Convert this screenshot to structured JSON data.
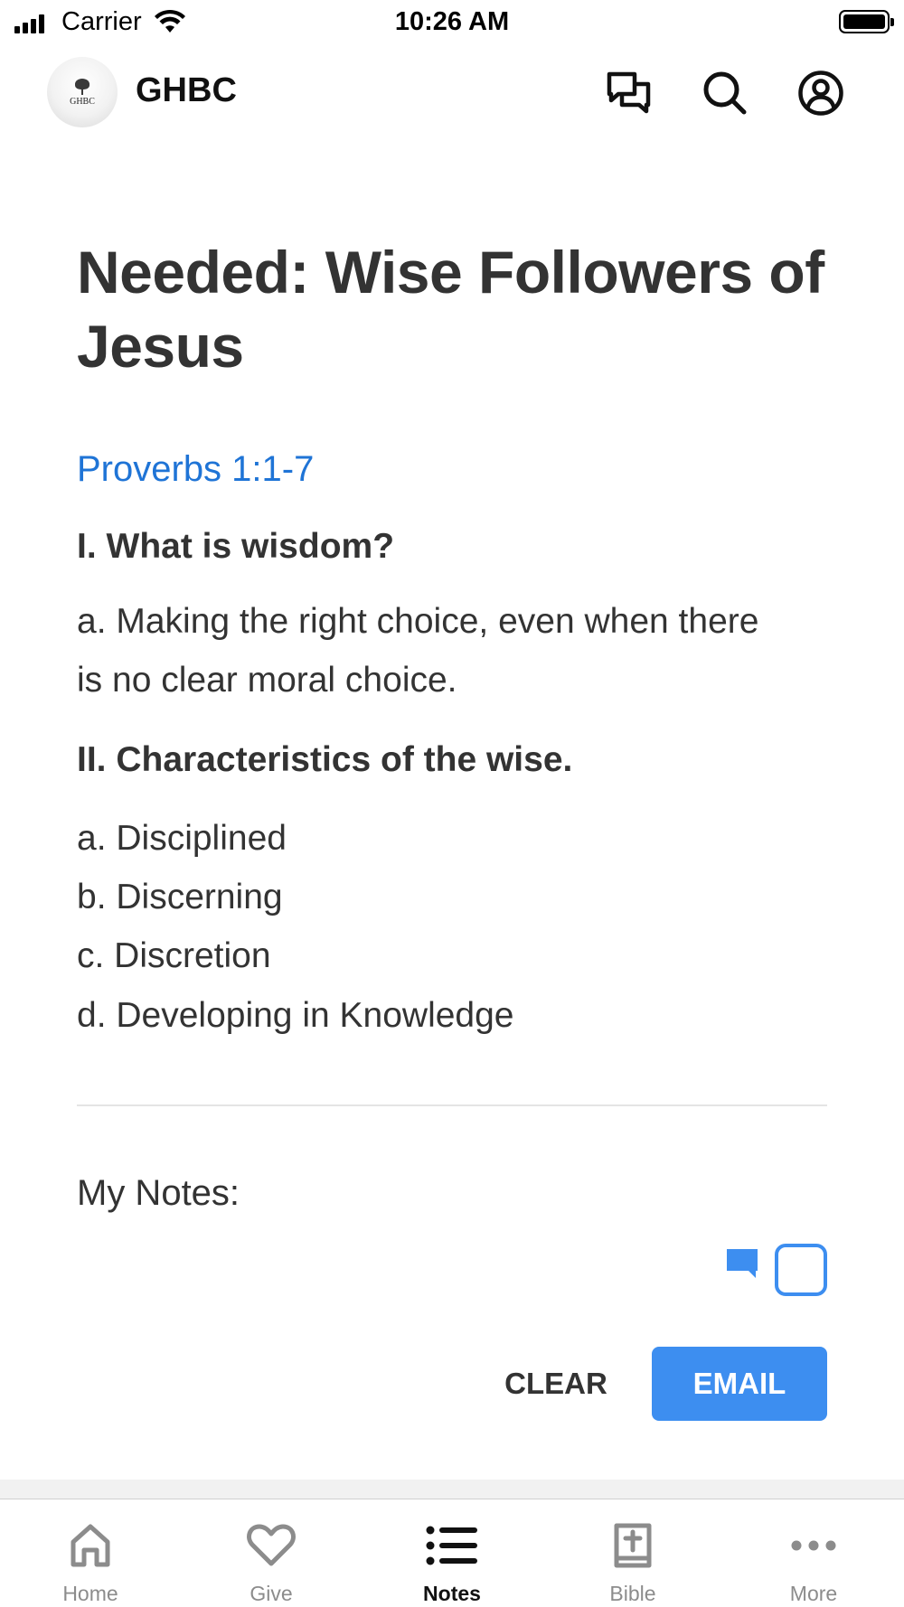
{
  "status_bar": {
    "carrier": "Carrier",
    "time": "10:26 AM",
    "icons": [
      "signal-icon",
      "wifi-icon",
      "battery-icon"
    ]
  },
  "header": {
    "logo_text": "GHBC",
    "app_name": "GHBC",
    "icons": [
      "messages-icon",
      "search-icon",
      "profile-icon"
    ]
  },
  "sermon": {
    "title": "Needed: Wise Followers of Jesus",
    "scripture_link": "Proverbs 1:1-7",
    "outline": {
      "heading_1": "I. What is wisdom?",
      "point_1a": "a. Making the right choice, even when there is no clear moral choice.",
      "heading_2": "II. Characteristics of the wise.",
      "point_2a": "a. Disciplined",
      "point_2b": "b. Discerning",
      "point_2c": "c. Discretion",
      "point_2d": "d. Developing in Knowledge"
    }
  },
  "notes": {
    "label": "My Notes:",
    "clear_label": "CLEAR",
    "email_label": "EMAIL"
  },
  "tab_bar": {
    "items": [
      {
        "label": "Home",
        "icon": "home-icon"
      },
      {
        "label": "Give",
        "icon": "heart-icon"
      },
      {
        "label": "Notes",
        "icon": "list-icon",
        "active": true
      },
      {
        "label": "Bible",
        "icon": "bible-icon"
      },
      {
        "label": "More",
        "icon": "more-icon"
      }
    ]
  },
  "colors": {
    "accent": "#3d8ef0",
    "link": "#1f74d6",
    "text": "#333333",
    "inactive_tab": "#8c8c8c"
  }
}
